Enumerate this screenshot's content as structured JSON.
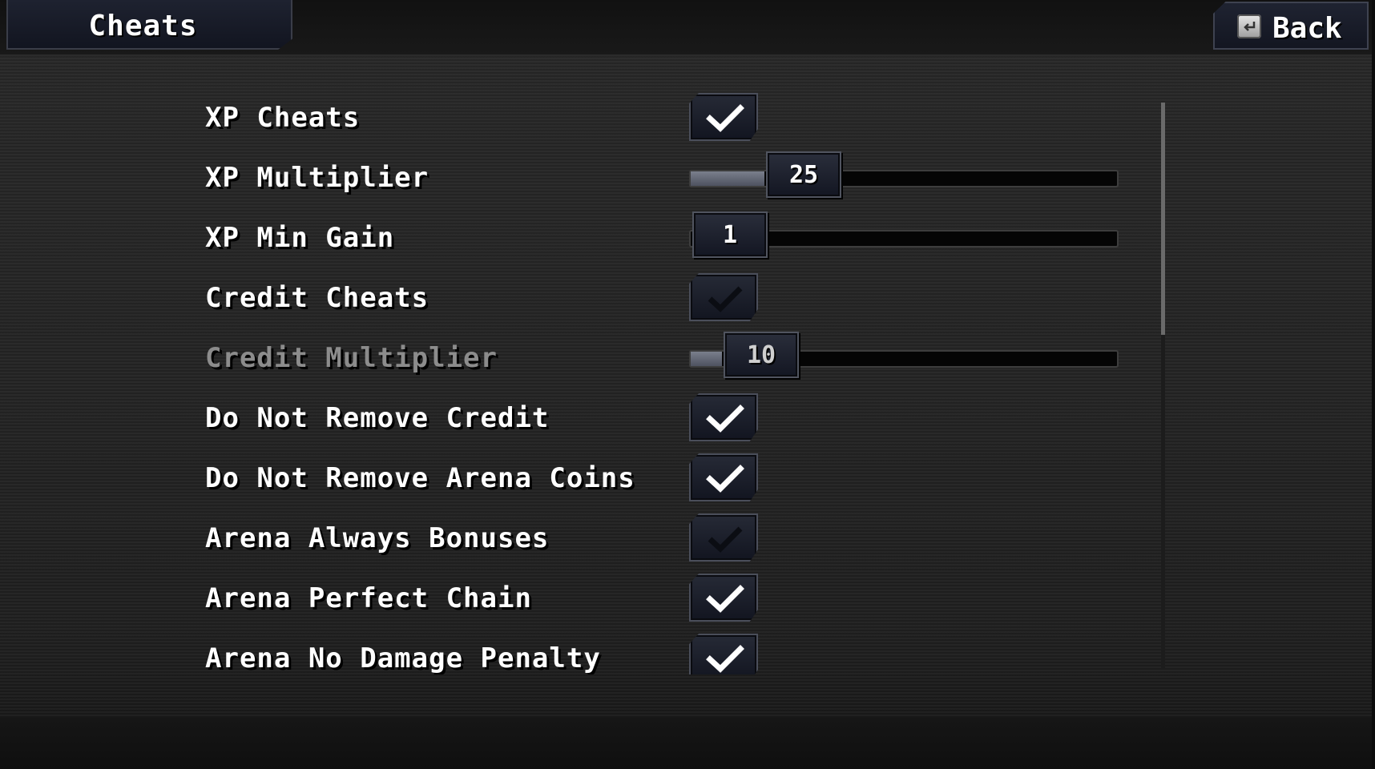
{
  "header": {
    "title": "Cheats",
    "back_label": "Back",
    "back_icon": "back-key-icon"
  },
  "settings": [
    {
      "label": "XP Cheats",
      "type": "checkbox",
      "checked": true,
      "disabled": false
    },
    {
      "label": "XP Multiplier",
      "type": "slider",
      "value": "25",
      "fill_fraction": 0.21,
      "disabled": false
    },
    {
      "label": "XP Min Gain",
      "type": "slider",
      "value": "1",
      "fill_fraction": 0.0,
      "disabled": false
    },
    {
      "label": "Credit Cheats",
      "type": "checkbox",
      "checked": false,
      "disabled": false
    },
    {
      "label": "Credit Multiplier",
      "type": "slider",
      "value": "10",
      "fill_fraction": 0.09,
      "disabled": true
    },
    {
      "label": "Do Not Remove Credit",
      "type": "checkbox",
      "checked": true,
      "disabled": false
    },
    {
      "label": "Do Not Remove Arena Coins",
      "type": "checkbox",
      "checked": true,
      "disabled": false
    },
    {
      "label": "Arena Always Bonuses",
      "type": "checkbox",
      "checked": false,
      "disabled": false
    },
    {
      "label": "Arena Perfect Chain",
      "type": "checkbox",
      "checked": true,
      "disabled": false
    },
    {
      "label": "Arena No Damage Penalty",
      "type": "checkbox",
      "checked": true,
      "disabled": false
    }
  ],
  "scrollbar": {
    "position_fraction": 0.0,
    "visible_fraction": 0.41
  },
  "colors": {
    "panel_dark": "#131621",
    "text": "#ffffff",
    "disabled_text": "#8c8c8c",
    "slider_fill": "#6a6f7c"
  }
}
